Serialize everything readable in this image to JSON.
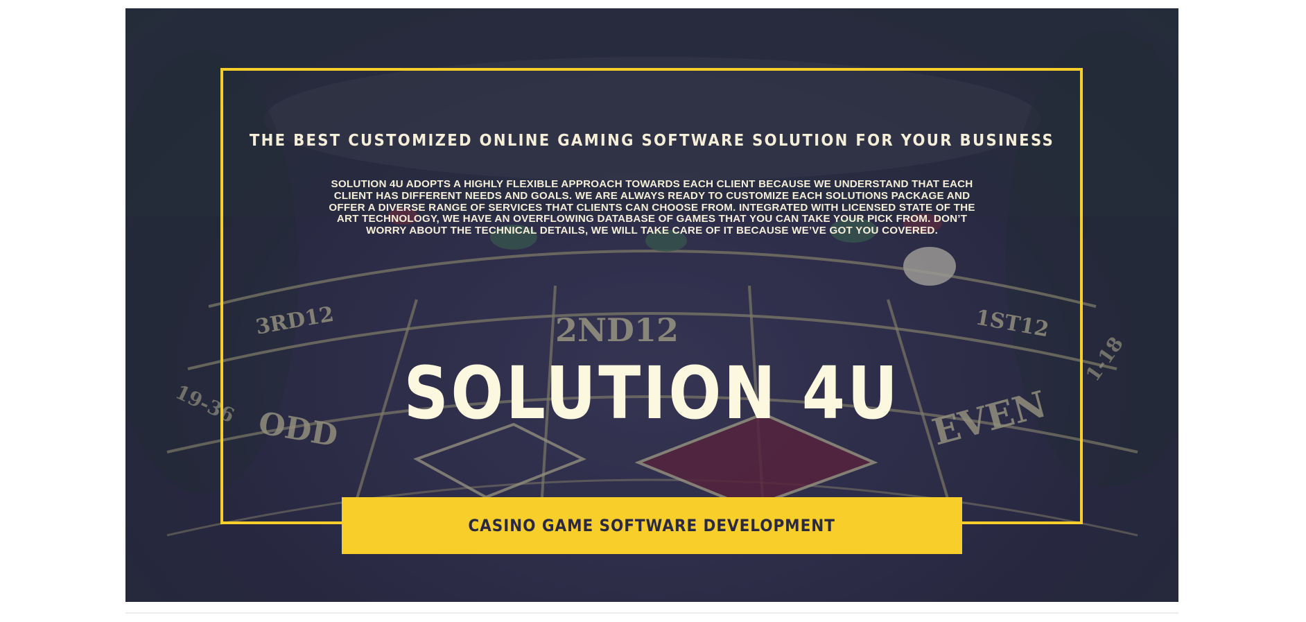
{
  "hero": {
    "headline": "THE BEST CUSTOMIZED ONLINE GAMING SOFTWARE SOLUTION FOR YOUR BUSINESS",
    "description_lines": [
      "SOLUTION 4U ADOPTS A HIGHLY FLEXIBLE APPROACH TOWARDS EACH CLIENT BECAUSE WE UNDERSTAND THAT EACH",
      "CLIENT HAS DIFFERENT NEEDS AND GOALS. WE ARE ALWAYS READY TO CUSTOMIZE EACH SOLUTIONS PACKAGE AND",
      "OFFER A DIVERSE RANGE OF SERVICES THAT CLIENTS CAN CHOOSE FROM. INTEGRATED WITH LICENSED STATE OF THE",
      "ART TECHNOLOGY, WE HAVE AN OVERFLOWING DATABASE OF GAMES THAT YOU CAN TAKE YOUR PICK FROM. DON’T",
      "WORRY ABOUT THE TECHNICAL DETAILS, WE WILL TAKE CARE OF IT BECAUSE WE’VE GOT YOU COVERED."
    ],
    "brand": "SOLUTION 4U",
    "banner": "CASINO GAME SOFTWARE DEVELOPMENT",
    "table_labels": {
      "dozen_3": "3RD12",
      "dozen_2": "2ND12",
      "dozen_1": "1ST12",
      "odd": "ODD",
      "even": "EVEN",
      "range_high": "19-36",
      "range_low": "1-18"
    }
  },
  "colors": {
    "frame": "#f8cf2a",
    "banner_bg": "#f8cf2a",
    "banner_text": "#2b2940",
    "text": "#f5efd9",
    "hero_overlay": "#2f2f4c",
    "diamond_red": "#6e1f3a"
  }
}
